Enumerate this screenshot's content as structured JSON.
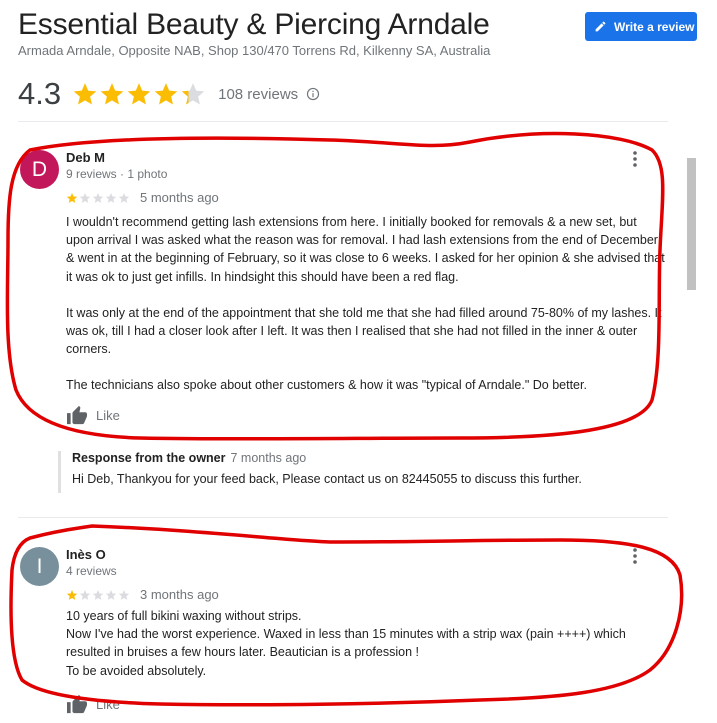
{
  "place": {
    "name": "Essential Beauty & Piercing Arndale",
    "address": "Armada Arndale, Opposite NAB, Shop 130/470 Torrens Rd, Kilkenny SA, Australia",
    "rating": "4.3",
    "rating_value": 4.3,
    "reviews_count": "108 reviews"
  },
  "write_review": {
    "label": "Write a review",
    "icon": "pencil-icon"
  },
  "colors": {
    "accent": "#1a73e8",
    "star": "#fbbc04",
    "star_empty": "#dadce0",
    "annotation": "#e00000",
    "avatar_deb": "#c2185b",
    "avatar_ines": "#78909c"
  },
  "reviews": [
    {
      "initial": "D",
      "author": "Deb M",
      "meta": "9 reviews · 1 photo",
      "stars": 1,
      "ago": "5 months ago",
      "paragraphs": [
        "I wouldn't recommend getting lash extensions from here. I initially booked for removals & a new set, but upon arrival I was asked what the reason was for removal. I had lash extensions from the end of December & went in at the beginning of February, so it was close to 6 weeks. I asked for her opinion & she advised that it was ok to just get infills. In hindsight this should have been a red flag.",
        "It was only at the end of the appointment that she told me that she had filled around 75-80% of my lashes. It was ok, till I had a closer look after I left. It was then I realised that she had not filled in the inner & outer corners.",
        "The technicians also spoke about other customers & how it was \"typical of Arndale.\" Do better."
      ],
      "like_label": "Like",
      "owner_response": {
        "title": "Response from the owner",
        "date": "7 months ago",
        "text": "Hi Deb, Thankyou for your feed back, Please contact us on 82445055 to discuss this further."
      }
    },
    {
      "initial": "I",
      "author": "Inès O",
      "meta": "4 reviews",
      "stars": 1,
      "ago": "3 months ago",
      "lines": [
        "10 years of full bikini waxing without strips.",
        "Now I've had the worst experience. Waxed in less than 15 minutes with a strip wax (pain ++++) which resulted in bruises a few hours later. Beautician is a profession !",
        "To be avoided absolutely."
      ],
      "like_label": "Like"
    }
  ]
}
